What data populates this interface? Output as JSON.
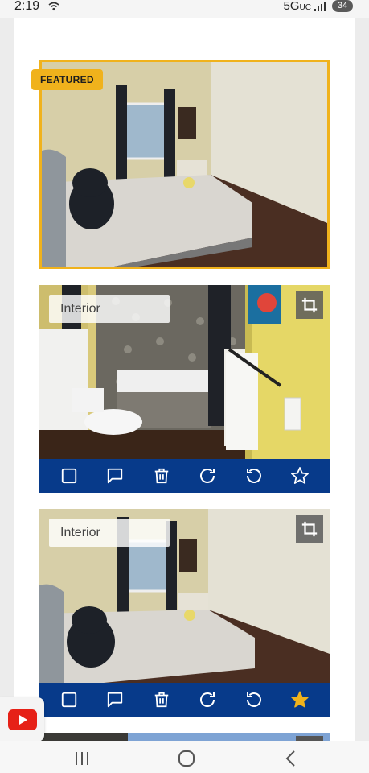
{
  "status_bar": {
    "time": "2:19",
    "network": "5G",
    "network_sub": "UC",
    "battery": "34"
  },
  "photos": [
    {
      "badge": "FEATURED",
      "scene": "bedroom",
      "featured": true
    },
    {
      "tag": "Interior",
      "scene": "bathroom",
      "starred": false
    },
    {
      "tag": "Interior",
      "scene": "bedroom",
      "starred": true
    }
  ],
  "toolbar_icons": [
    "checkbox-icon",
    "comment-icon",
    "trash-icon",
    "rotate-right-icon",
    "rotate-left-icon",
    "star-icon"
  ],
  "colors": {
    "featured_accent": "#f0b21c",
    "toolbar_bg": "#073a8a",
    "star_active": "#f0b21c"
  },
  "nav": [
    "recent-apps-icon",
    "home-icon",
    "back-icon"
  ]
}
